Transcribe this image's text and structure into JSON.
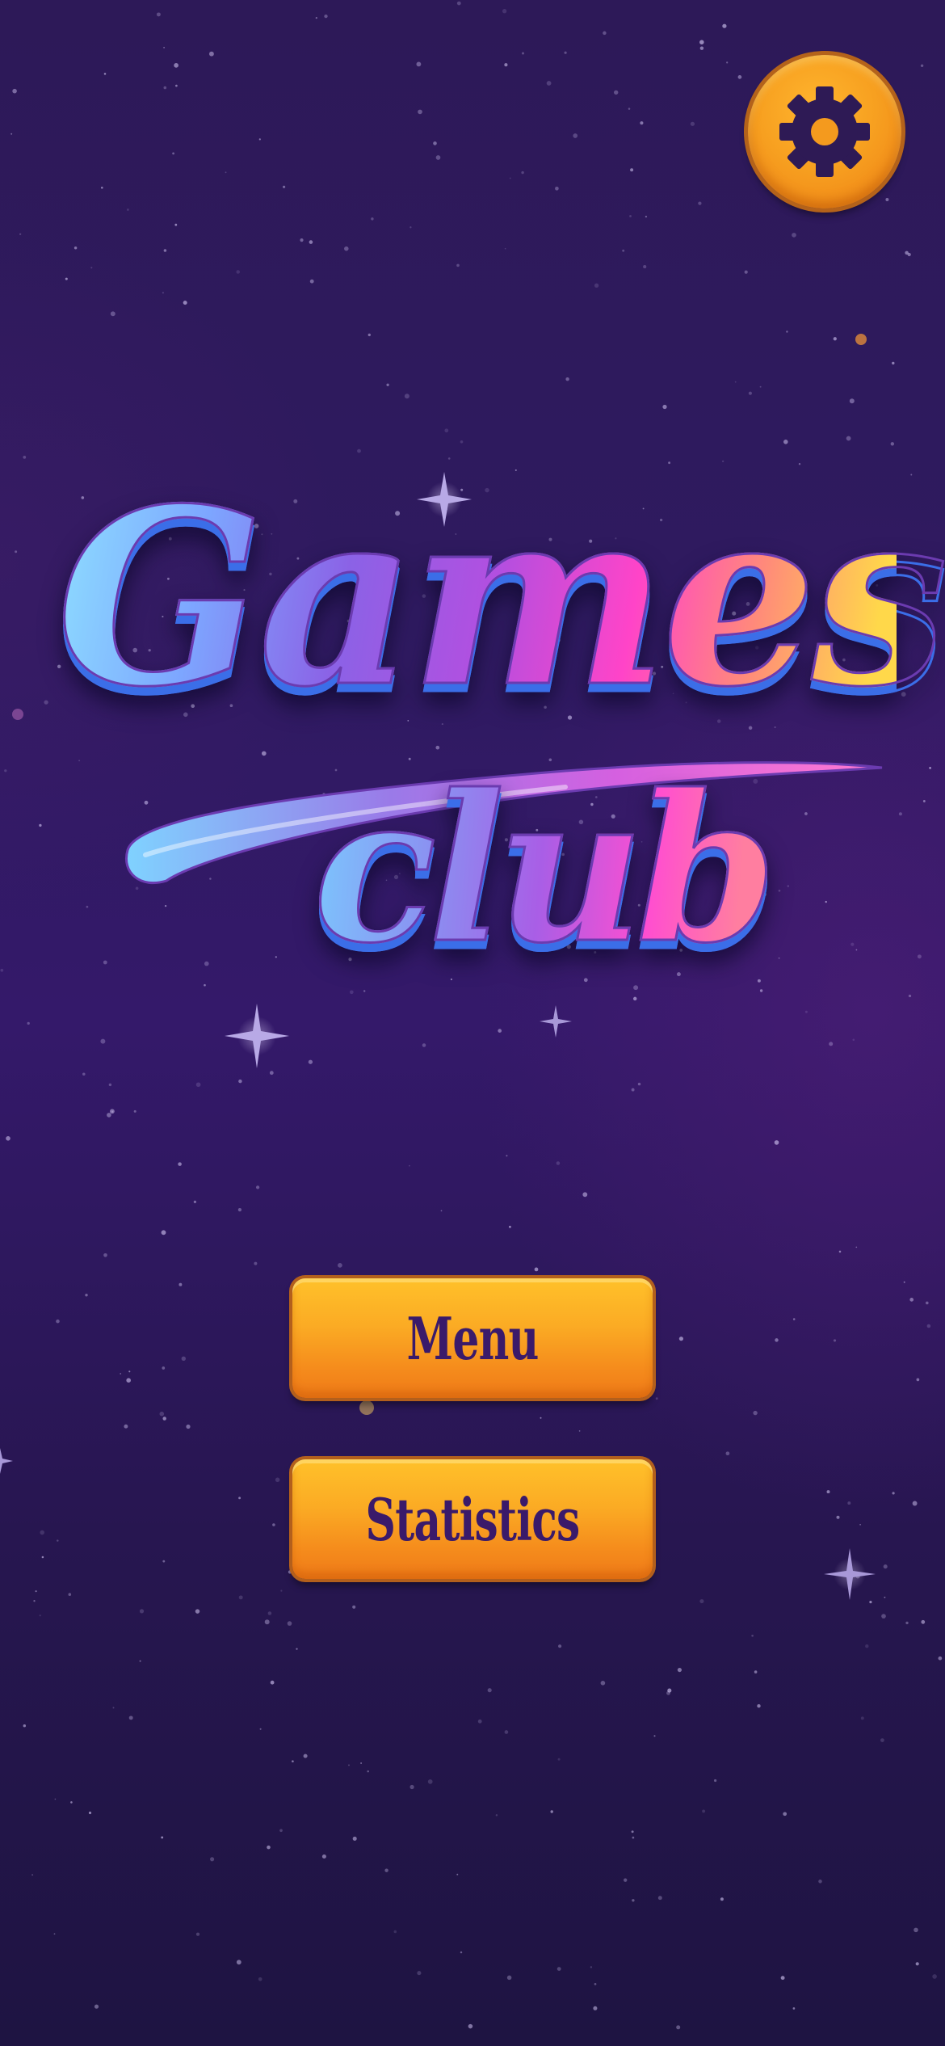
{
  "logo": {
    "title": "Games",
    "subtitle": "club"
  },
  "settings": {
    "icon": "gear-icon"
  },
  "buttons": {
    "menu_label": "Menu",
    "statistics_label": "Statistics"
  },
  "colors": {
    "background": "#2d1958",
    "button_orange": "#f7a020",
    "button_text": "#3a1a6a",
    "gear": "#2e1a55"
  }
}
